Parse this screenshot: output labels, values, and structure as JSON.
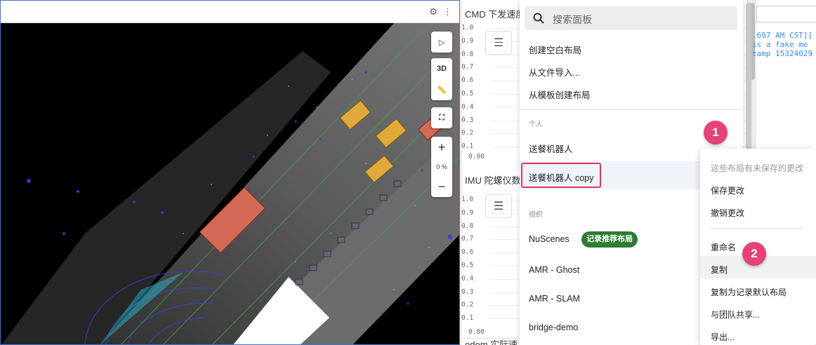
{
  "plots": [
    {
      "title": "CMD 下发速度",
      "y_top": "1.0",
      "ticks": [
        "1.0",
        "0.9",
        "0.8",
        "0.7",
        "0.6",
        "0.5",
        "0.4",
        "0.3",
        "0.2",
        "0.1"
      ],
      "y_bottom": "0.00"
    },
    {
      "title": "IMU 陀螺仪数",
      "y_top": "1.0",
      "ticks": [
        "1.0",
        "0.9",
        "0.8",
        "0.7",
        "0.6",
        "0.5",
        "0.4",
        "0.3",
        "0.2",
        "0.1"
      ],
      "y_bottom": "0.00"
    },
    {
      "title": "odom 实际速"
    }
  ],
  "viewport": {
    "mode_3d": "3D",
    "zoom": "0 %"
  },
  "log": {
    "lines": [
      ".697 AM CST][",
      " is a fake me",
      "tamp 15324029"
    ]
  },
  "layout_menu": {
    "search_placeholder": "搜索面板",
    "actions": [
      "创建空白布局",
      "从文件导入...",
      "从模板创建布局"
    ],
    "personal_header": "个人",
    "personal_items": [
      "送餐机器人",
      "送餐机器人 copy"
    ],
    "org_header": "组织",
    "org_items": [
      "NuScenes",
      "AMR - Ghost",
      "AMR - SLAM",
      "bridge-demo"
    ],
    "recommended_badge": "记录推荐布局"
  },
  "context_menu": {
    "unsaved_notice": "这些布局有未保存的更改",
    "items": [
      "保存更改",
      "撤销更改",
      "重命名",
      "复制",
      "复制为记录默认布局",
      "与团队共享...",
      "导出..."
    ]
  },
  "markers": [
    "1",
    "2"
  ],
  "colors": {
    "accent_pink": "#e54377",
    "badge_green": "#2e7d32",
    "panel_border_blue": "#4b73c9",
    "log_text_blue": "#3a8ee6"
  }
}
